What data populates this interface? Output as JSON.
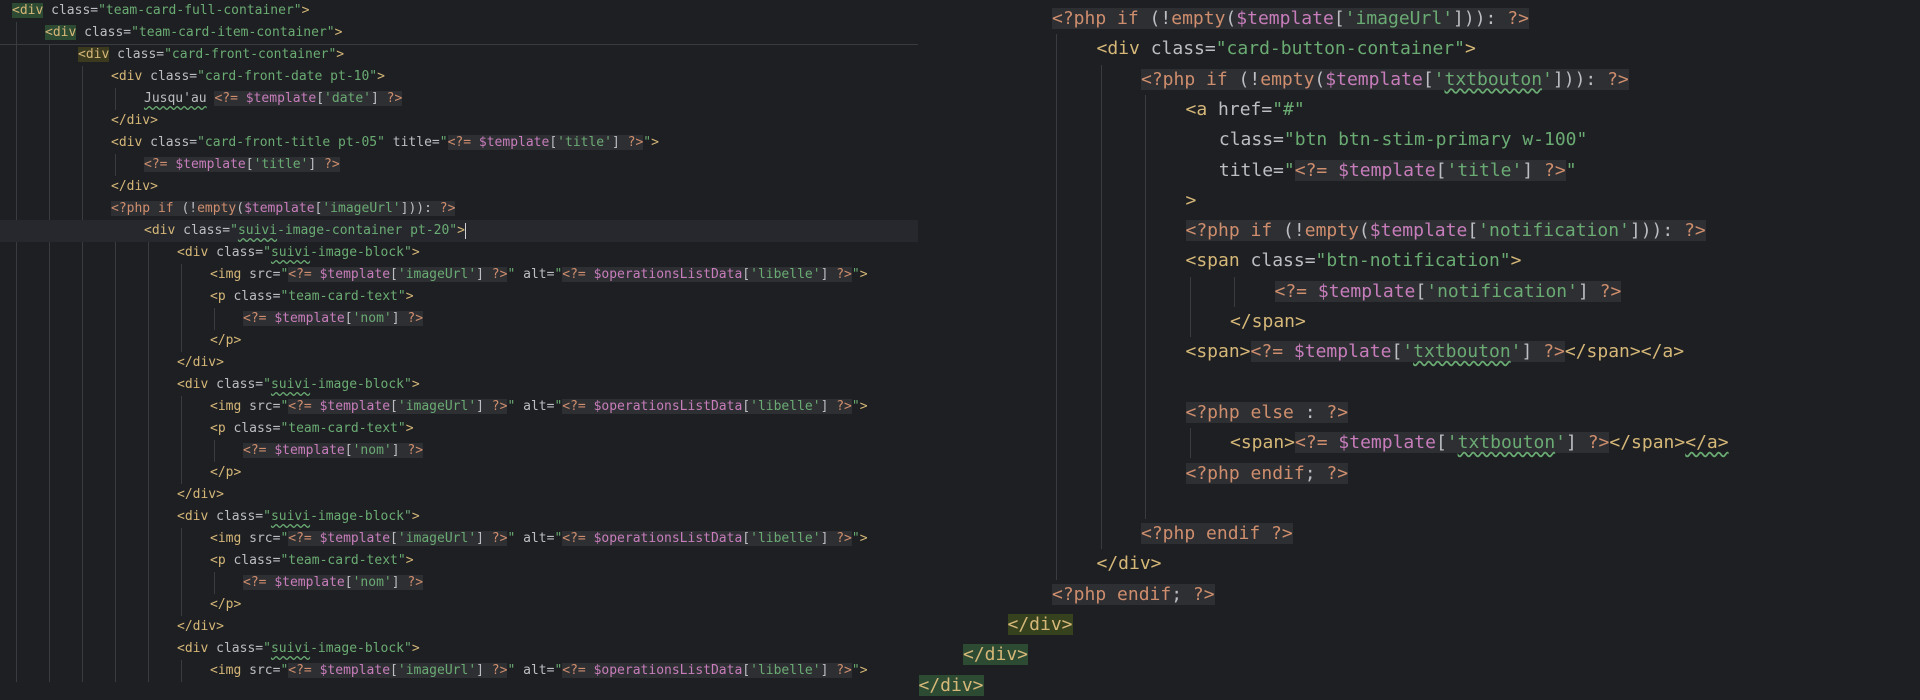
{
  "app": {
    "name": "Code editor",
    "view": "split"
  },
  "editor": {
    "left_pane": {
      "lines": [
        [
          "<div",
          " class=",
          "\"team-card-full-container\"",
          ">"
        ],
        [
          "<div",
          " class=",
          "\"team-card-item-container\"",
          ">"
        ],
        [
          "<div",
          " class=",
          "\"card-front-container\"",
          ">"
        ],
        [
          "<div",
          " class=",
          "\"card-front-date pt-10\"",
          ">"
        ],
        [
          "Jusqu'au",
          " ",
          "<?= ",
          "$template",
          "[",
          "'date'",
          "]",
          " ?>"
        ],
        [
          "</div>"
        ],
        [
          "<div",
          " class=",
          "\"card-front-title pt-05\"",
          " title=",
          "\"",
          "<?= ",
          "$template",
          "[",
          "'title'",
          "]",
          " ?>",
          "\"",
          ">"
        ],
        [
          "<?= ",
          "$template",
          "[",
          "'title'",
          "]",
          " ?>"
        ],
        [
          "</div>"
        ],
        [
          "<?php ",
          "if",
          " (!",
          "empty",
          "(",
          "$template",
          "[",
          "'imageUrl'",
          "])):",
          " ?>"
        ],
        [
          "<div",
          " class=",
          "\"",
          "suivi",
          "-image-container pt-20\"",
          ">"
        ],
        [
          "<div",
          " class=",
          "\"",
          "suivi",
          "-image-block\"",
          ">"
        ],
        [
          "<img",
          " src=",
          "\"",
          "<?= ",
          "$template",
          "[",
          "'imageUrl'",
          "]",
          " ?>",
          "\"",
          " alt=",
          "\"",
          "<?= ",
          "$operationsListData",
          "[",
          "'libelle'",
          "]",
          " ?>",
          "\"",
          ">"
        ],
        [
          "<p",
          " class=",
          "\"team-card-text\"",
          ">"
        ],
        [
          "<?= ",
          "$template",
          "[",
          "'nom'",
          "]",
          " ?>"
        ],
        [
          "</p>"
        ],
        [
          "</div>"
        ],
        [
          "<div",
          " class=",
          "\"",
          "suivi",
          "-image-block\"",
          ">"
        ],
        [
          "<img",
          " src=",
          "\"",
          "<?= ",
          "$template",
          "[",
          "'imageUrl'",
          "]",
          " ?>",
          "\"",
          " alt=",
          "\"",
          "<?= ",
          "$operationsListData",
          "[",
          "'libelle'",
          "]",
          " ?>",
          "\"",
          ">"
        ],
        [
          "<p",
          " class=",
          "\"team-card-text\"",
          ">"
        ],
        [
          "<?= ",
          "$template",
          "[",
          "'nom'",
          "]",
          " ?>"
        ],
        [
          "</p>"
        ],
        [
          "</div>"
        ],
        [
          "<div",
          " class=",
          "\"",
          "suivi",
          "-image-block\"",
          ">"
        ],
        [
          "<img",
          " src=",
          "\"",
          "<?= ",
          "$template",
          "[",
          "'imageUrl'",
          "]",
          " ?>",
          "\"",
          " alt=",
          "\"",
          "<?= ",
          "$operationsListData",
          "[",
          "'libelle'",
          "]",
          " ?>",
          "\"",
          ">"
        ],
        [
          "<p",
          " class=",
          "\"team-card-text\"",
          ">"
        ],
        [
          "<?= ",
          "$template",
          "[",
          "'nom'",
          "]",
          " ?>"
        ],
        [
          "</p>"
        ],
        [
          "</div>"
        ],
        [
          "<div",
          " class=",
          "\"",
          "suivi",
          "-image-block\"",
          ">"
        ],
        [
          "<img",
          " src=",
          "\"",
          "<?= ",
          "$template",
          "[",
          "'imageUrl'",
          "]",
          " ?>",
          "\"",
          " alt=",
          "\"",
          "<?= ",
          "$operationsListData",
          "[",
          "'libelle'",
          "]",
          " ?>",
          "\"",
          ">"
        ]
      ]
    },
    "right_pane": {
      "lines": [
        [
          "<?php ",
          "if",
          " (!",
          "empty",
          "(",
          "$template",
          "[",
          "'imageUrl'",
          "])):",
          " ?>"
        ],
        [
          "<div",
          " class=",
          "\"card-button-container\"",
          ">"
        ],
        [
          "<?php ",
          "if",
          " (!",
          "empty",
          "(",
          "$template",
          "[",
          "'",
          "txtbouton",
          "'",
          "])):",
          " ?>"
        ],
        [
          "<a",
          " href=",
          "\"#\""
        ],
        [
          "class=",
          "\"btn btn-stim-primary w-100\""
        ],
        [
          "title=",
          "\"",
          "<?= ",
          "$template",
          "[",
          "'title'",
          "]",
          " ?>",
          "\""
        ],
        [
          ">"
        ],
        [
          "<?php ",
          "if",
          " (!",
          "empty",
          "(",
          "$template",
          "[",
          "'notification'",
          "])):",
          " ?>"
        ],
        [
          "<span",
          " class=",
          "\"btn-notification\"",
          ">"
        ],
        [
          "<?= ",
          "$template",
          "[",
          "'notification'",
          "]",
          " ?>"
        ],
        [
          "</span>"
        ],
        [
          "<span>",
          "<?= ",
          "$template",
          "[",
          "'",
          "txtbouton",
          "'",
          "]",
          " ?>",
          "</span></a>"
        ],
        [
          ""
        ],
        [
          "<?php ",
          "else",
          " : ",
          "?>"
        ],
        [
          "<span>",
          "<?= ",
          "$template",
          "[",
          "'",
          "txtbouton",
          "'",
          "]",
          " ?>",
          "</span>",
          "</a>"
        ],
        [
          "<?php ",
          "endif",
          "; ",
          "?>"
        ],
        [
          ""
        ],
        [
          "<?php ",
          "endif",
          " ?>"
        ],
        [
          "</div>"
        ],
        [
          "<?php ",
          "endif",
          "; ",
          "?>"
        ],
        [
          "</div>"
        ],
        [
          "</div>"
        ],
        [
          "</div>"
        ]
      ]
    }
  }
}
